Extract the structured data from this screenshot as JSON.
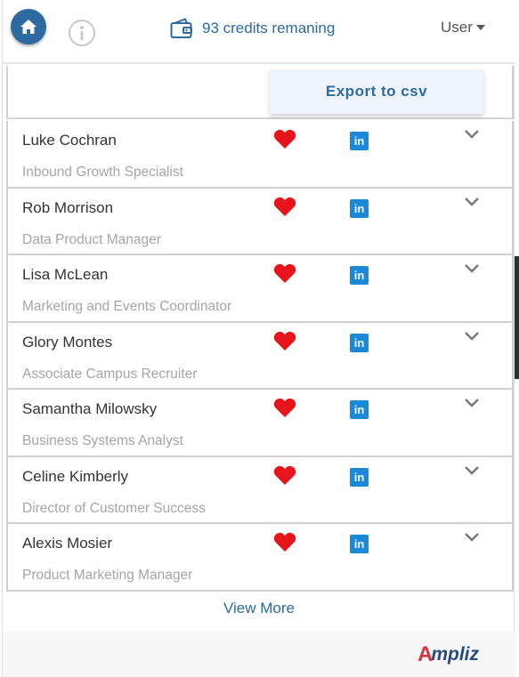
{
  "header": {
    "credits_text": "93 credits remaning",
    "user_label": "User"
  },
  "toolbar": {
    "export_label": "Export to csv"
  },
  "contacts": [
    {
      "name": "Luke Cochran",
      "title": "Inbound Growth Specialist"
    },
    {
      "name": "Rob Morrison",
      "title": "Data Product Manager"
    },
    {
      "name": "Lisa McLean",
      "title": "Marketing and Events Coordinator"
    },
    {
      "name": "Glory Montes",
      "title": "Associate Campus Recruiter"
    },
    {
      "name": "Samantha Milowsky",
      "title": "Business Systems Analyst"
    },
    {
      "name": "Celine Kimberly",
      "title": "Director of Customer Success"
    },
    {
      "name": "Alexis Mosier",
      "title": "Product Marketing Manager"
    }
  ],
  "linkedin_glyph": "in",
  "view_more_label": "View More",
  "brand": {
    "name": "Ampliz"
  },
  "colors": {
    "accent": "#2c6aa0",
    "heart": "#e8141b",
    "linkedin": "#1a8ad8",
    "brand_red": "#d9333f",
    "brand_navy": "#2a4a7f"
  },
  "icons": [
    "home-icon",
    "info-icon",
    "wallet-icon",
    "heart-icon",
    "linkedin-icon",
    "chevron-down-icon"
  ]
}
